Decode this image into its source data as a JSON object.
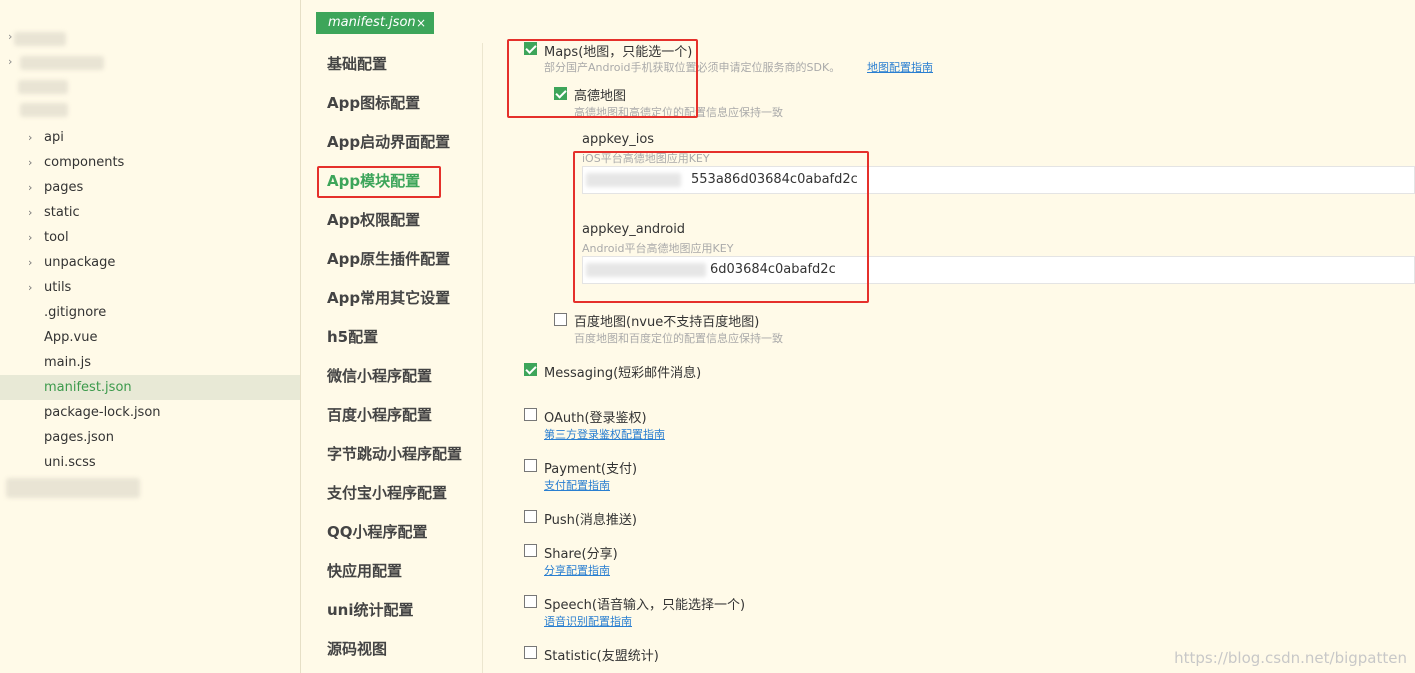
{
  "file_tree": {
    "items": [
      {
        "label": "api",
        "folder": true
      },
      {
        "label": "components",
        "folder": true
      },
      {
        "label": "pages",
        "folder": true
      },
      {
        "label": "static",
        "folder": true
      },
      {
        "label": "tool",
        "folder": true
      },
      {
        "label": "unpackage",
        "folder": true
      },
      {
        "label": "utils",
        "folder": true
      },
      {
        "label": ".gitignore",
        "folder": false
      },
      {
        "label": "App.vue",
        "folder": false
      },
      {
        "label": "main.js",
        "folder": false
      },
      {
        "label": "manifest.json",
        "folder": false,
        "active": true
      },
      {
        "label": "package-lock.json",
        "folder": false
      },
      {
        "label": "pages.json",
        "folder": false
      },
      {
        "label": "uni.scss",
        "folder": false
      }
    ]
  },
  "tab": {
    "label": "manifest.json",
    "close": "×"
  },
  "settings_nav": {
    "items": [
      "基础配置",
      "App图标配置",
      "App启动界面配置",
      "App模块配置",
      "App权限配置",
      "App原生插件配置",
      "App常用其它设置",
      "h5配置",
      "微信小程序配置",
      "百度小程序配置",
      "字节跳动小程序配置",
      "支付宝小程序配置",
      "QQ小程序配置",
      "快应用配置",
      "uni统计配置",
      "源码视图"
    ],
    "active_index": 3
  },
  "modules": {
    "maps": {
      "label": "Maps(地图，只能选一个)",
      "checked": true,
      "desc": "部分国产Android手机获取位置必须申请定位服务商的SDK。",
      "link": "地图配置指南"
    },
    "amap": {
      "label": "高德地图",
      "checked": true,
      "desc": "高德地图和高德定位的配置信息应保持一致"
    },
    "appkey_ios": {
      "label": "appkey_ios",
      "desc": "iOS平台高德地图应用KEY",
      "value": "553a86d03684c0abafd2c"
    },
    "appkey_android": {
      "label": "appkey_android",
      "desc": "Android平台高德地图应用KEY",
      "value": "6d03684c0abafd2c"
    },
    "baidu_map": {
      "label": "百度地图(nvue不支持百度地图)",
      "checked": false,
      "desc": "百度地图和百度定位的配置信息应保持一致"
    },
    "messaging": {
      "label": "Messaging(短彩邮件消息)",
      "checked": true
    },
    "oauth": {
      "label": "OAuth(登录鉴权)",
      "checked": false,
      "link": "第三方登录鉴权配置指南"
    },
    "payment": {
      "label": "Payment(支付)",
      "checked": false,
      "link": "支付配置指南"
    },
    "push": {
      "label": "Push(消息推送)",
      "checked": false
    },
    "share": {
      "label": "Share(分享)",
      "checked": false,
      "link": "分享配置指南"
    },
    "speech": {
      "label": "Speech(语音输入，只能选择一个)",
      "checked": false,
      "link": "语音识别配置指南"
    },
    "statistic": {
      "label": "Statistic(友盟统计)",
      "checked": false
    }
  },
  "watermark": "https://blog.csdn.net/bigpatten",
  "colors": {
    "accent": "#3da55a",
    "highlight": "#e5302b",
    "link": "#2a7fd1",
    "background": "#fffae8"
  }
}
